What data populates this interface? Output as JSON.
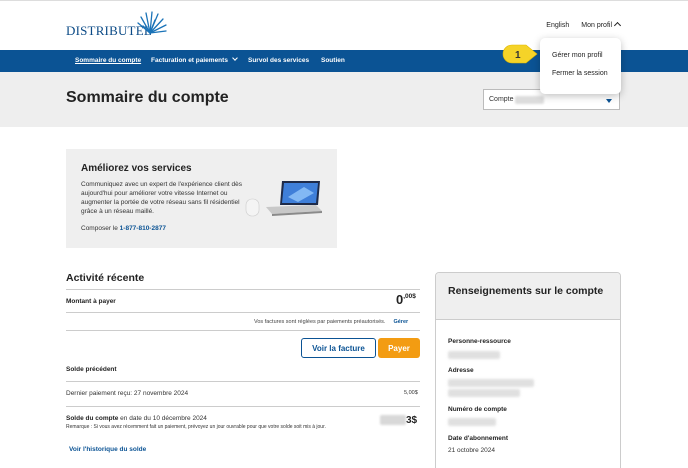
{
  "brand": {
    "logo_text": "DISTRIBUTEL",
    "primary_color": "#0b5394",
    "accent_color": "#f39c12"
  },
  "top_links": {
    "language": "English",
    "profile": "Mon profil"
  },
  "nav": {
    "items": [
      {
        "label": "Sommaire du compte",
        "active": true
      },
      {
        "label": "Facturation et paiements",
        "has_dropdown": true
      },
      {
        "label": "Survol des services"
      },
      {
        "label": "Soutien"
      }
    ]
  },
  "profile_menu": {
    "items": [
      "Gérer mon profil",
      "Fermer la session"
    ]
  },
  "step_badge": "1",
  "page": {
    "title": "Sommaire du compte",
    "account_label": "Compte"
  },
  "promo": {
    "title": "Améliorez vos services",
    "text": "Communiquez avec un expert de l'expérience client dès aujourd'hui pour améliorer votre vitesse Internet ou augmenter la portée de votre réseau sans fil résidentiel grâce à un réseau maillé.",
    "phone_prefix": "Composer le",
    "phone": "1-877-810-2877"
  },
  "activity": {
    "title": "Activité récente",
    "amount_label": "Montant à payer",
    "amount_main": "0",
    "amount_cents": ",00$",
    "preauth_note": "Vos factures sont réglées par paiements préautorisés.",
    "manage_link": "Gérer",
    "view_bill_button": "Voir la facture",
    "pay_button": "Payer",
    "previous_balance_label": "Solde précédent",
    "last_payment": "Dernier paiement reçu: 27 novembre 2024",
    "last_payment_amount": "5,00$",
    "balance_label_bold": "Solde du compte",
    "balance_label_rest": " en date du 10 décembre 2024",
    "balance_note": "Remarque : Si vous avez récemment fait un paiement, prévoyez un jour ouvrable pour que votre solde soit mis à jour.",
    "balance_amount_suffix": "3$",
    "history_link": "Voir l'historique du solde"
  },
  "account_info": {
    "title": "Renseignements sur le compte",
    "contact_label": "Personne-ressource",
    "address_label": "Adresse",
    "phone_label": "Numéro de compte",
    "subscription_label": "Date d'abonnement",
    "subscription_date": "21 octobre 2024"
  }
}
